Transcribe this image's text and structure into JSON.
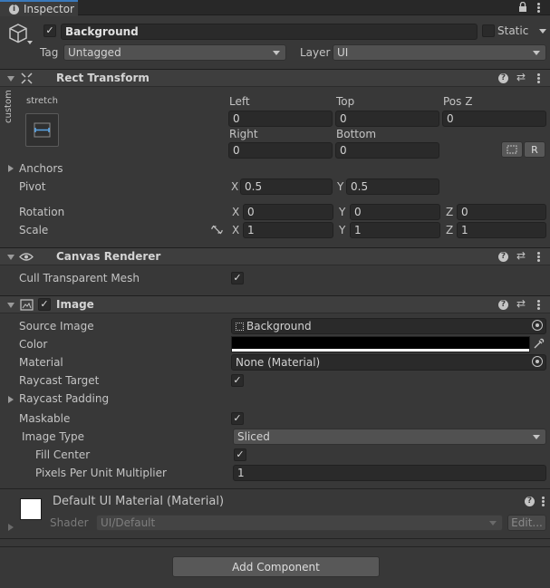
{
  "tab": {
    "title": "Inspector"
  },
  "gameobject": {
    "name": "Background",
    "static_label": "Static",
    "tag_label": "Tag",
    "tag_value": "Untagged",
    "layer_label": "Layer",
    "layer_value": "UI"
  },
  "rect_transform": {
    "title": "Rect Transform",
    "anchor_preset_h": "stretch",
    "anchor_preset_v": "custom",
    "headers": [
      "Left",
      "Top",
      "Pos Z",
      "Right",
      "Bottom"
    ],
    "left": "0",
    "top": "0",
    "pos_z": "0",
    "right": "0",
    "bottom": "0",
    "anchors_label": "Anchors",
    "pivot_label": "Pivot",
    "pivot": {
      "x": "0.5",
      "y": "0.5"
    },
    "rotation_label": "Rotation",
    "rotation": {
      "x": "0",
      "y": "0",
      "z": "0"
    },
    "scale_label": "Scale",
    "scale": {
      "x": "1",
      "y": "1",
      "z": "1"
    },
    "axis": {
      "x": "X",
      "y": "Y",
      "z": "Z"
    },
    "raw_button": "R"
  },
  "canvas_renderer": {
    "title": "Canvas Renderer",
    "cull_label": "Cull Transparent Mesh"
  },
  "image": {
    "title": "Image",
    "source_image_label": "Source Image",
    "source_image_value": "Background",
    "color_label": "Color",
    "color_value": "#000000",
    "material_label": "Material",
    "material_value": "None (Material)",
    "raycast_target_label": "Raycast Target",
    "raycast_padding_label": "Raycast Padding",
    "maskable_label": "Maskable",
    "image_type_label": "Image Type",
    "image_type_value": "Sliced",
    "fill_center_label": "Fill Center",
    "ppu_label": "Pixels Per Unit Multiplier",
    "ppu_value": "1"
  },
  "material": {
    "title": "Default UI Material (Material)",
    "shader_label": "Shader",
    "shader_value": "UI/Default",
    "edit_button": "Edit..."
  },
  "add_component": "Add Component"
}
